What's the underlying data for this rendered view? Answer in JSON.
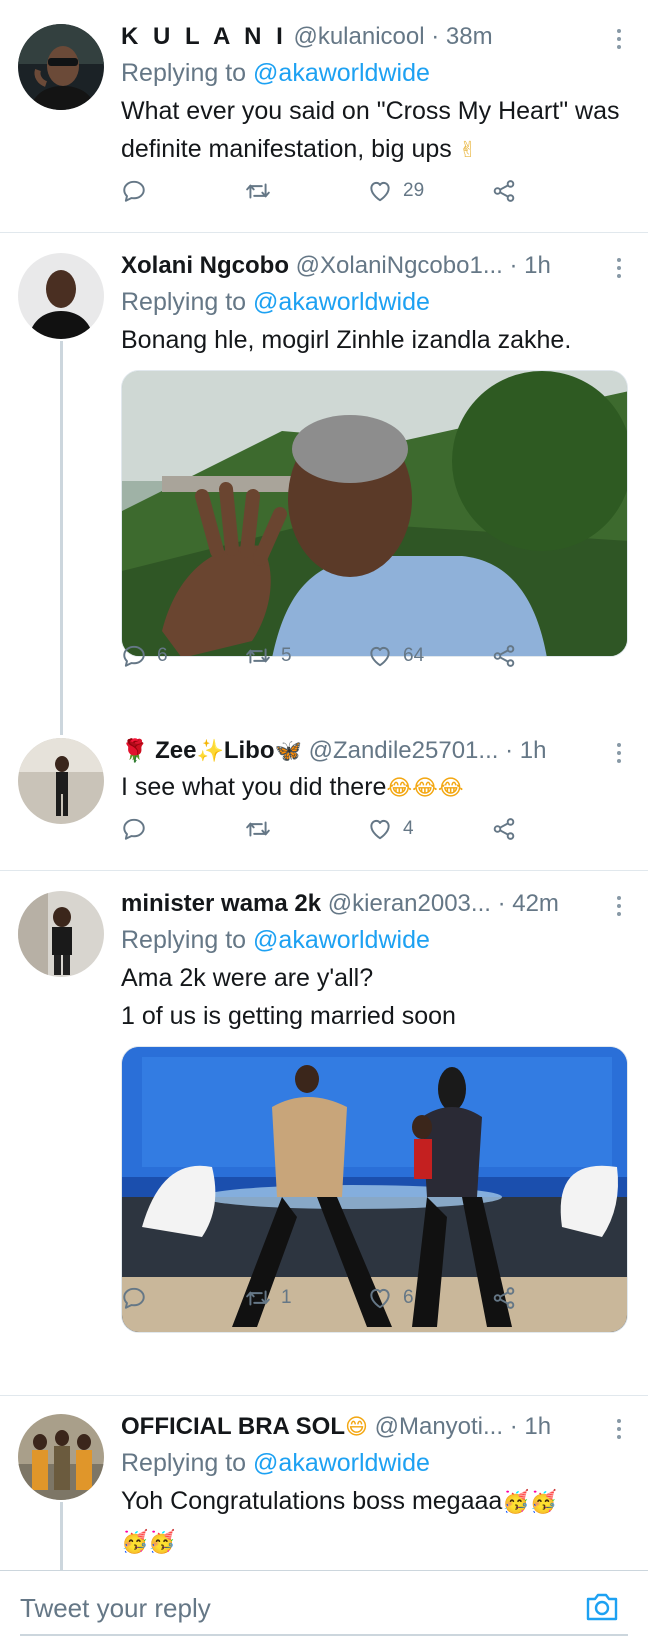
{
  "colors": {
    "accent": "#1da1f2",
    "secondary_text": "#657786",
    "divider": "#e1e8ed"
  },
  "tweets": [
    {
      "name": "K U L A N I",
      "handle": "@kulanicool",
      "time": "· 38m",
      "replying_prefix": "Replying to ",
      "replying_to": "@akaworldwide",
      "text": "What ever you said on \"Cross My Heart\" was definite manifestation, big ups ",
      "emoji": "✌",
      "replies": "",
      "retweets": "",
      "likes": "29"
    },
    {
      "name": "Xolani Ngcobo",
      "handle": "@XolaniNgcobo1...",
      "time": "· 1h",
      "replying_prefix": "Replying to ",
      "replying_to": "@akaworldwide",
      "text": "Bonang hle, mogirl Zinhle izandla zakhe.",
      "replies": "6",
      "retweets": "5",
      "likes": "64"
    },
    {
      "name_rose": "🌹",
      "name_a": "Zee",
      "name_sparkle": "✨",
      "name_b": "Libo",
      "name_butterfly": "🦋",
      "handle": "@Zandile25701...",
      "time": "· 1h",
      "text": "I see what you did there",
      "emoji": "😂😂😂",
      "replies": "",
      "retweets": "",
      "likes": "4"
    },
    {
      "name": "minister wama 2k",
      "handle": "@kieran2003...",
      "time": "· 42m",
      "replying_prefix": "Replying to ",
      "replying_to": "@akaworldwide",
      "text_line1": "Ama 2k were are y'all?",
      "text_line2": "1 of us is getting married soon",
      "replies": "",
      "retweets": "1",
      "likes": "6"
    },
    {
      "name": "OFFICIAL BRA SOL",
      "name_emoji": "😄",
      "handle": "@Manyoti...",
      "time": "· 1h",
      "replying_prefix": "Replying to ",
      "replying_to": "@akaworldwide",
      "text": "Yoh Congratulations boss megaaa",
      "emoji_a": "🥳🥳",
      "emoji_b": "🥳🥳"
    }
  ],
  "composer": {
    "placeholder": "Tweet your reply"
  },
  "icons": [
    "reply-icon",
    "retweet-icon",
    "like-icon",
    "share-icon",
    "more-icon",
    "camera-icon"
  ]
}
